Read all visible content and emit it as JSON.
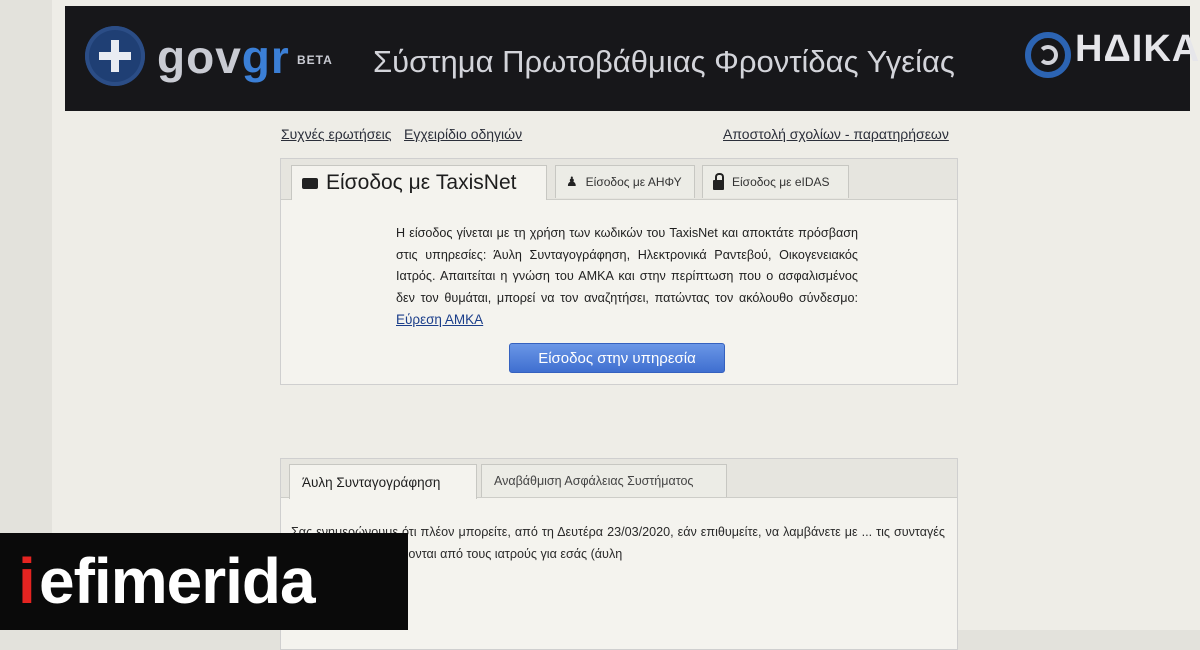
{
  "header": {
    "logo_gov": "gov",
    "logo_gr": "gr",
    "beta": "BETA",
    "system_title": "Σύστημα Πρωτοβάθμιας Φροντίδας Υγείας",
    "partner_logo": "ΗΔΙΚΑ"
  },
  "links": {
    "faq": "Συχνές ερωτήσεις",
    "manual": "Εγχειρίδιο οδηγιών",
    "feedback": "Αποστολή σχολίων - παρατηρήσεων"
  },
  "login_tabs": [
    {
      "label": "Είσοδος με TaxisNet",
      "icon": "id-card-icon",
      "active": true
    },
    {
      "label": "Είσοδος με ΑΗΦΥ",
      "icon": "user-icon",
      "active": false
    },
    {
      "label": "Είσοδος με eIDAS",
      "icon": "lock-icon",
      "active": false
    }
  ],
  "login": {
    "description": "Η είσοδος γίνεται με τη χρήση των κωδικών του TaxisNet και αποκτάτε πρόσβαση στις υπηρεσίες: Άυλη Συνταγογράφηση, Ηλεκτρονικά Ραντεβού, Οικογενειακός Ιατρός. Απαιτείται η γνώση του ΑΜΚΑ και στην περίπτωση που ο ασφαλισμένος δεν τον θυμάται, μπορεί να τον αναζητήσει, πατώντας τον ακόλουθο σύνδεσμο:",
    "amka_link": "Εύρεση ΑΜΚΑ",
    "button": "Είσοδος στην υπηρεσία"
  },
  "info_tabs": [
    {
      "label": "Άυλη Συνταγογράφηση",
      "active": true
    },
    {
      "label": "Αναβάθμιση Ασφάλειας Συστήματος",
      "active": false
    }
  ],
  "info": {
    "text": "Σας ενημερώνουμε ότι πλέον μπορείτε, από τη Δευτέρα 23/03/2020, εάν επιθυμείτε, να λαμβάνετε με ... τις συνταγές φαρμάκων που εκδίδονται από τους ιατρούς για εσάς (άυλη"
  },
  "watermark": {
    "first": "i",
    "rest": "efimerida"
  }
}
